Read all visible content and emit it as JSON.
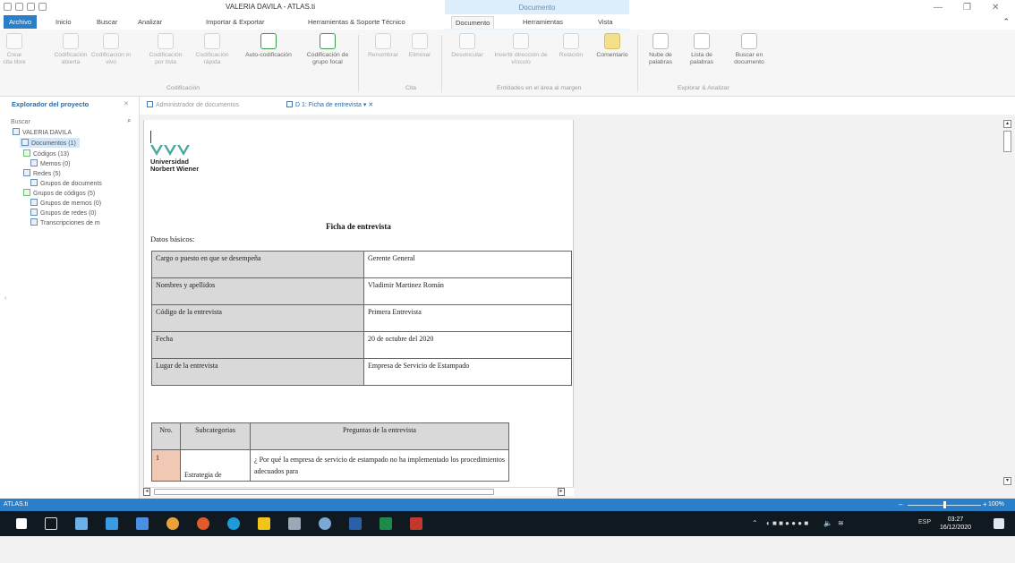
{
  "window": {
    "title": "VALERIA DAVILA - ATLAS.ti",
    "context_group": "Documento",
    "controls": {
      "minimize": "—",
      "restore": "❐",
      "close": "✕"
    }
  },
  "ribbon_tabs": [
    {
      "label": "Archivo"
    },
    {
      "label": "Inicio"
    },
    {
      "label": "Buscar"
    },
    {
      "label": "Analizar"
    },
    {
      "label": "Importar & Exportar"
    },
    {
      "label": "Herramientas & Soporte Técnico"
    },
    {
      "label": "Documento"
    },
    {
      "label": "Herramientas"
    },
    {
      "label": "Vista"
    }
  ],
  "ribbon": {
    "buttons": [
      {
        "label": "Crear cita libre",
        "enabled": false
      },
      {
        "label": "Codificación abierta",
        "enabled": false
      },
      {
        "label": "Codificación in vivo",
        "enabled": false
      },
      {
        "label": "Codificación por lista",
        "enabled": false
      },
      {
        "label": "Codificación rápida",
        "enabled": false
      },
      {
        "label": "Auto-codificación",
        "enabled": true
      },
      {
        "label": "Codificación de grupo focal",
        "enabled": true
      },
      {
        "label": "Renombrar",
        "enabled": false
      },
      {
        "label": "Eliminar",
        "enabled": false
      },
      {
        "label": "Desvincular",
        "enabled": false
      },
      {
        "label": "Invertir dirección de vínculo",
        "enabled": false
      },
      {
        "label": "Relación",
        "enabled": false
      },
      {
        "label": "Comentario",
        "enabled": true
      },
      {
        "label": "Nube de palabras",
        "enabled": true
      },
      {
        "label": "Lista de palabras",
        "enabled": true
      },
      {
        "label": "Buscar en documento",
        "enabled": true
      }
    ],
    "groups": [
      "Codificación",
      "Cita",
      "Entidades en el área al margen",
      "Explorar & Analizar"
    ]
  },
  "left_panel": {
    "title": "Explorador del proyecto",
    "close": "✕",
    "search_placeholder": "Buscar",
    "tree": [
      {
        "label": "VALERIA DAVILA"
      },
      {
        "label": "Documentos (1)"
      },
      {
        "label": "Códigos (13)"
      },
      {
        "label": "Memos (0)"
      },
      {
        "label": "Redes (5)"
      },
      {
        "label": "Grupos de documents"
      },
      {
        "label": "Grupos de códigos (5)"
      },
      {
        "label": "Grupos de memos (0)"
      },
      {
        "label": "Grupos de redes (0)"
      },
      {
        "label": "Transcripciones de m"
      }
    ]
  },
  "doc_tabs": [
    {
      "label": "Administrador de documentos"
    },
    {
      "label": "D 1: Ficha de entrevista"
    }
  ],
  "document": {
    "logo_text_1": "Universidad",
    "logo_text_2": "Norbert Wiener",
    "heading": "Ficha de entrevista",
    "subheading": "Datos básicos:",
    "info_rows": [
      {
        "label": "Cargo o puesto en que se desempeña",
        "value": "Gerente General"
      },
      {
        "label": "Nombres y apellidos",
        "value": "Vladimir Martinez Román"
      },
      {
        "label": "Código de la entrevista",
        "value": "Primera Entrevista"
      },
      {
        "label": "Fecha",
        "value": " 20 de octubre del 2020"
      },
      {
        "label": "Lugar de la entrevista",
        "value": "Empresa de Servicio de Estampado"
      }
    ],
    "questions_table": {
      "headers": [
        "Nro.",
        "Subcategorias",
        "Preguntas de la entrevista"
      ],
      "rows": [
        {
          "nro": "1",
          "sub": "Estrategia de",
          "pregunta": "¿ Por qué la empresa de servicio de estampado no ha implementado los procedimientos adecuados para"
        }
      ]
    }
  },
  "statusbar": {
    "label": "ATLAS.ti",
    "zoom": "100%",
    "zoom_level": 0.5
  },
  "taskbar": {
    "lang": "ESP",
    "time": "03:27",
    "date": "16/12/2020"
  }
}
